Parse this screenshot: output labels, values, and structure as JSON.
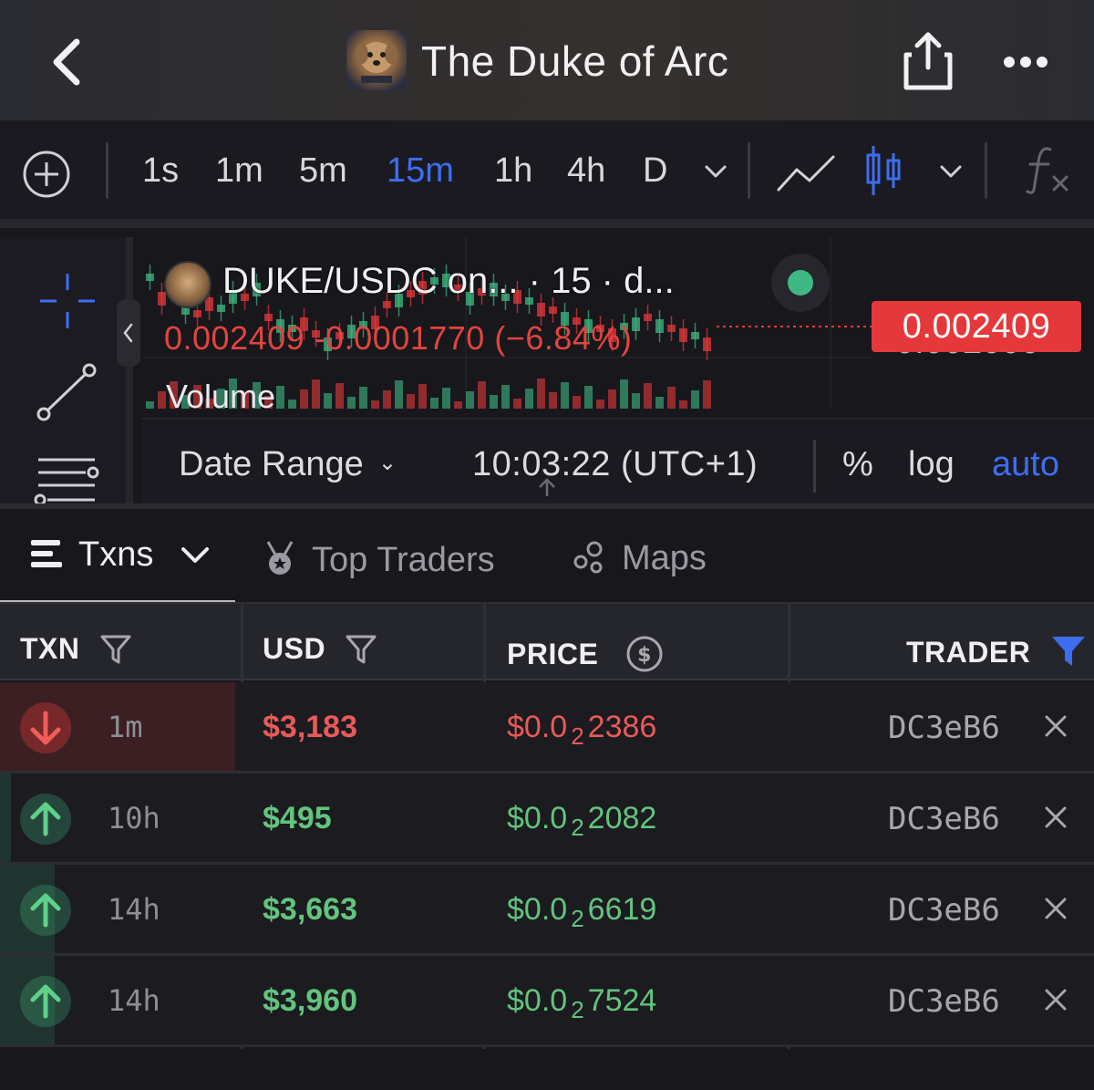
{
  "header": {
    "title": "The Duke of Arc",
    "logo_text": "THE DUKE OF ARC"
  },
  "toolbar": {
    "timeframes": [
      "1s",
      "1m",
      "5m",
      "15m",
      "1h",
      "4h",
      "D"
    ],
    "active_timeframe": "15m",
    "icons": [
      "add-indicator-icon",
      "chevron-down-icon",
      "line-chart-icon",
      "candlestick-icon",
      "chevron-down-icon",
      "function-icon"
    ],
    "accent_color": "#3e6df0"
  },
  "chart": {
    "pair_label": "DUKE/USDC on... · 15 · d...",
    "ohlc_text": "0.002409 -0.0001770 (−6.84%)",
    "volume_label": "Volume",
    "last_price": "0.002409",
    "axis_price": "0.002000",
    "date_range_label": "Date Range",
    "time_label": "10:03:22 (UTC+1)",
    "pct_label": "%",
    "log_label": "log",
    "auto_label": "auto",
    "down_color": "#e5383b",
    "up_color": "#3fb983"
  },
  "tabs": [
    {
      "label": "Txns",
      "icon": "list-icon"
    },
    {
      "label": "Top Traders",
      "icon": "medal-icon"
    },
    {
      "label": "Maps",
      "icon": "bubbles-icon"
    }
  ],
  "table": {
    "headers": {
      "txn": "TXN",
      "usd": "USD",
      "price": "PRICE",
      "trader": "TRADER"
    },
    "rows": [
      {
        "side": "sell",
        "age": "1m",
        "usd": "$3,183",
        "price_prefix": "$0.0",
        "price_sub": "2",
        "price_digits": "2386",
        "trader": "DC3eB6"
      },
      {
        "side": "buy",
        "age": "10h",
        "usd": "$495",
        "price_prefix": "$0.0",
        "price_sub": "2",
        "price_digits": "2082",
        "trader": "DC3eB6"
      },
      {
        "side": "buy",
        "age": "14h",
        "usd": "$3,663",
        "price_prefix": "$0.0",
        "price_sub": "2",
        "price_digits": "6619",
        "trader": "DC3eB6"
      },
      {
        "side": "buy",
        "age": "14h",
        "usd": "$3,960",
        "price_prefix": "$0.0",
        "price_sub": "2",
        "price_digits": "7524",
        "trader": "DC3eB6"
      }
    ]
  }
}
